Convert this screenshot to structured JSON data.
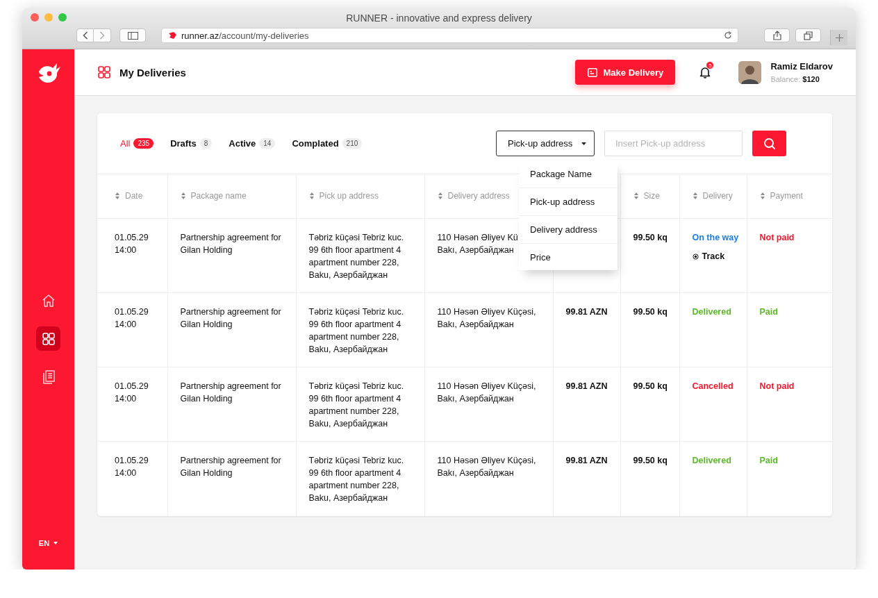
{
  "browser": {
    "title": "RUNNER - innovative and express delivery",
    "url_domain": "runner.az",
    "url_path": "/account/my-deliveries"
  },
  "sidebar": {
    "items": [
      {
        "kind": "home",
        "selected": false
      },
      {
        "kind": "grid",
        "selected": true
      },
      {
        "kind": "documents",
        "selected": false
      }
    ],
    "language": "EN"
  },
  "header": {
    "title": "My Deliveries",
    "action": "Make Delivery",
    "notifications": "5",
    "user": {
      "name": "Ramiz Eldarov",
      "balance_label": "Balance:",
      "balance": "$120"
    }
  },
  "filters": {
    "tabs": [
      {
        "label": "All",
        "count": "235",
        "selected": true
      },
      {
        "label": "Drafts",
        "count": "8",
        "selected": false
      },
      {
        "label": "Active",
        "count": "14",
        "selected": false
      },
      {
        "label": "Complated",
        "count": "210",
        "selected": false
      }
    ],
    "search_by": "Pick-up address",
    "placeholder": "Insert Pick-up address",
    "dropdown_open": true,
    "options": [
      "Package Name",
      "Pick-up address",
      "Delivery address",
      "Price"
    ]
  },
  "table": {
    "columns": [
      {
        "label": "Date"
      },
      {
        "label": "Package name"
      },
      {
        "label": "Pick up address"
      },
      {
        "label": "Delivery address"
      },
      {},
      {
        "label": "Size"
      },
      {
        "label": "Delivery"
      },
      {
        "label": "Payment"
      }
    ],
    "rows": [
      {
        "date": "01.05.29",
        "time": "14:00",
        "package": "Partnership agreement for\nGilan Holding",
        "pickup": "Təbriz küçəsi Tebriz kuc.\n99 6th floor apartment 4\napartment number 228,\nBaku, Азербайджан",
        "delivery_address": "110 Həsən Əliyev Kü\nBakı, Азербайджан",
        "size": "99.50 kq",
        "delivery": {
          "label": "On the way",
          "color": "#1a7fe0"
        },
        "track": "Track",
        "payment": {
          "label": "Not paid",
          "color": "#f0192f"
        }
      },
      {
        "date": "01.05.29",
        "time": "14:00",
        "package": "Partnership agreement for\nGilan Holding",
        "pickup": "Təbriz küçəsi Tebriz kuc.\n99 6th floor apartment 4\napartment number 228,\nBaku, Азербайджан",
        "delivery_address": "110 Həsən Əliyev Küçəsi,\nBakı, Азербайджан",
        "price": "99.81 AZN",
        "size": "99.50 kq",
        "delivery": {
          "label": "Delivered",
          "color": "#5cb82a"
        },
        "payment": {
          "label": "Paid",
          "color": "#5cb82a"
        }
      },
      {
        "date": "01.05.29",
        "time": "14:00",
        "package": "Partnership agreement for\nGilan Holding",
        "pickup": "Təbriz küçəsi Tebriz kuc.\n99 6th floor apartment 4\napartment number 228,\nBaku, Азербайджан",
        "delivery_address": "110 Həsən Əliyev Küçəsi,\nBakı, Азербайджан",
        "price": "99.81 AZN",
        "size": "99.50 kq",
        "delivery": {
          "label": "Cancelled",
          "color": "#f0192f"
        },
        "payment": {
          "label": "Not paid",
          "color": "#f0192f"
        }
      },
      {
        "date": "01.05.29",
        "time": "14:00",
        "package": "Partnership agreement for\nGilan Holding",
        "pickup": "Təbriz küçəsi Tebriz kuc.\n99 6th floor apartment 4\napartment number 228,\nBaku, Азербайджан",
        "delivery_address": "110 Həsən Əliyev Küçəsi,\nBakı, Азербайджан",
        "price": "99.81 AZN",
        "size": "99.50 kq",
        "delivery": {
          "label": "Delivered",
          "color": "#5cb82a"
        },
        "payment": {
          "label": "Paid",
          "color": "#5cb82a"
        }
      }
    ]
  }
}
